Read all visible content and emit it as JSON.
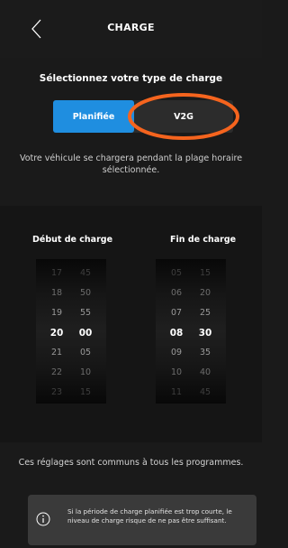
{
  "header": {
    "title": "CHARGE",
    "back_icon": "chevron-left-icon"
  },
  "charge_type": {
    "title": "Sélectionnez votre type de charge",
    "options": [
      "Planifiée",
      "V2G"
    ],
    "selected": "Planifiée",
    "accent_color": "#1f8ee0",
    "annotation_color": "#f5641e"
  },
  "info_text": "Votre véhicule se chargera pendant la plage horaire sélectionnée.",
  "debut": {
    "label": "Début de charge",
    "hours": [
      "17",
      "18",
      "19",
      "20",
      "21",
      "22",
      "23"
    ],
    "minutes": [
      "45",
      "50",
      "55",
      "00",
      "05",
      "10",
      "15"
    ],
    "selected_hour": "20",
    "selected_minute": "00"
  },
  "fin": {
    "label": "Fin de charge",
    "hours": [
      "05",
      "06",
      "07",
      "08",
      "09",
      "10",
      "11"
    ],
    "minutes": [
      "15",
      "20",
      "25",
      "30",
      "35",
      "40",
      "45"
    ],
    "selected_hour": "08",
    "selected_minute": "30"
  },
  "common_text": "Ces réglages sont communs à tous les programmes.",
  "warning": {
    "icon": "info-icon",
    "text": "Si la période de charge planifiée est trop courte, le niveau de charge risque de ne pas être suffisant."
  }
}
